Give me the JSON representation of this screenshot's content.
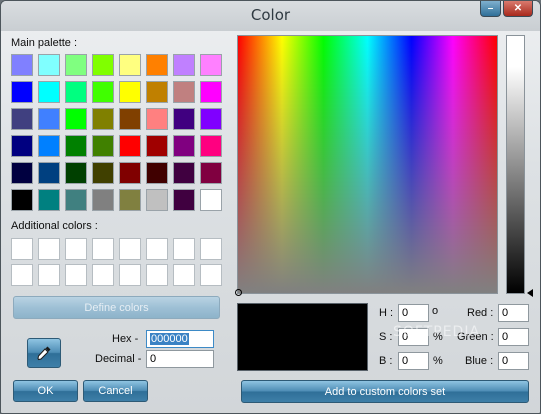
{
  "window": {
    "title": "Color",
    "minimize_glyph": "–",
    "close_glyph": "✕"
  },
  "main_palette": {
    "label": "Main palette :",
    "rows": [
      [
        "#8080ff",
        "#80ffff",
        "#80ff80",
        "#80ff00",
        "#ffff80",
        "#ff8000",
        "#c080ff",
        "#ff80ff"
      ],
      [
        "#0000ff",
        "#00ffff",
        "#00ff80",
        "#40ff00",
        "#ffff00",
        "#c08000",
        "#c08080",
        "#ff00ff"
      ],
      [
        "#404080",
        "#4080ff",
        "#00ff00",
        "#808000",
        "#804000",
        "#ff8080",
        "#400080",
        "#8000ff"
      ],
      [
        "#000080",
        "#0080ff",
        "#008000",
        "#408000",
        "#ff0000",
        "#a00000",
        "#800080",
        "#ff0080"
      ],
      [
        "#000040",
        "#004080",
        "#004000",
        "#404000",
        "#800000",
        "#400000",
        "#400040",
        "#800040"
      ],
      [
        "#000000",
        "#008080",
        "#408080",
        "#808080",
        "#808040",
        "#c0c0c0",
        "#400040",
        "#ffffff"
      ]
    ]
  },
  "additional_colors": {
    "label": "Additional colors :",
    "rows": [
      [
        "#ffffff",
        "#ffffff",
        "#ffffff",
        "#ffffff",
        "#ffffff",
        "#ffffff",
        "#ffffff",
        "#ffffff"
      ],
      [
        "#ffffff",
        "#ffffff",
        "#ffffff",
        "#ffffff",
        "#ffffff",
        "#ffffff",
        "#ffffff",
        "#ffffff"
      ]
    ]
  },
  "buttons": {
    "define_colors": "Define colors",
    "ok": "OK",
    "cancel": "Cancel",
    "add_custom": "Add to custom colors set"
  },
  "fields": {
    "hex_label": "Hex -",
    "hex_value": "000000",
    "decimal_label": "Decimal -",
    "decimal_value": "0",
    "h_label": "H :",
    "h_value": "0",
    "h_unit": "o",
    "s_label": "S :",
    "s_value": "0",
    "s_unit": "%",
    "b_label": "B :",
    "b_value": "0",
    "b_unit": "%",
    "red_label": "Red :",
    "red_value": "0",
    "green_label": "Green :",
    "green_value": "0",
    "blue_label": "Blue :",
    "blue_value": "0"
  },
  "preview": {
    "current_color": "#000000"
  },
  "icons": {
    "eyedropper": "eyedropper-icon",
    "minimize": "minimize-icon",
    "close": "close-icon"
  },
  "watermark": "SOFTPEDIA"
}
